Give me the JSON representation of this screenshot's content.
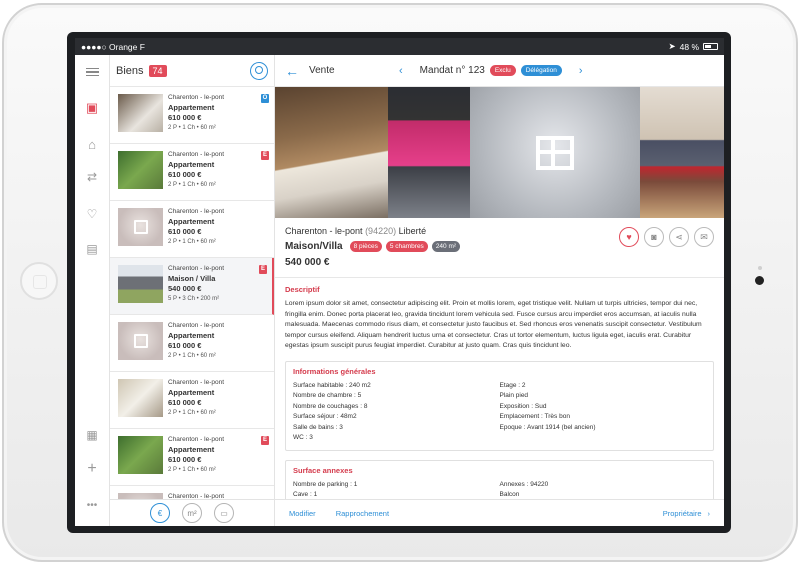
{
  "statusbar": {
    "carrier": "●●●●○ Orange F",
    "time": "",
    "battery": "48 %"
  },
  "list": {
    "title": "Biens",
    "count": "74",
    "items": [
      {
        "location": "Charenton - le-pont",
        "type": "Appartement",
        "price": "610 000 €",
        "details": "2 P • 1 Ch • 60 m²",
        "tag": "O"
      },
      {
        "location": "Charenton - le-pont",
        "type": "Appartement",
        "price": "610 000 €",
        "details": "2 P • 1 Ch • 60 m²",
        "tag": "E"
      },
      {
        "location": "Charenton - le-pont",
        "type": "Appartement",
        "price": "610 000 €",
        "details": "2 P • 1 Ch • 60 m²",
        "tag": ""
      },
      {
        "location": "Charenton - le-pont",
        "type": "Maison / Villa",
        "price": "540 000 €",
        "details": "5 P • 3 Ch • 200 m²",
        "tag": "E"
      },
      {
        "location": "Charenton - le-pont",
        "type": "Appartement",
        "price": "610 000 €",
        "details": "2 P • 1 Ch • 60 m²",
        "tag": ""
      },
      {
        "location": "Charenton - le-pont",
        "type": "Appartement",
        "price": "610 000 €",
        "details": "2 P • 1 Ch • 60 m²",
        "tag": ""
      },
      {
        "location": "Charenton - le-pont",
        "type": "Appartement",
        "price": "610 000 €",
        "details": "2 P • 1 Ch • 60 m²",
        "tag": "E"
      },
      {
        "location": "Charenton - le-pont",
        "type": "",
        "price": "",
        "details": "",
        "tag": ""
      }
    ],
    "footer": [
      "€",
      "m²",
      "▭"
    ]
  },
  "detail": {
    "back_label": "Vente",
    "mandat": "Mandat n° 123",
    "badge_exclu": "Exclu",
    "badge_delegation": "Délégation",
    "location_city": "Charenton - le-pont",
    "location_zip": "(94220)",
    "location_street": "Liberté",
    "type": "Maison/Villa",
    "pill_rooms": "8 pièces",
    "pill_bedrooms": "5 chambres",
    "pill_area": "240 m²",
    "price": "540 000 €",
    "desc_title": "Descriptif",
    "description": "Lorem ipsum dolor sit amet, consectetur adipiscing elit. Proin et mollis lorem, eget tristique velit. Nullam ut turpis ultricies, tempor dui nec, fringilla enim. Donec porta placerat leo, gravida tincidunt lorem vehicula sed. Fusce cursus arcu imperdiet eros accumsan, at iaculis nulla malesuada. Maecenas commodo risus diam, et consectetur justo faucibus et. Sed rhoncus eros venenatis suscipit consectetur. Vestibulum tempor cursus eleifend. Aliquam hendrerit luctus urna et consectetur. Cras ut tortor elementum, luctus ligula eget, iaculis erat. Curabitur egestas ipsum suscipit purus feugiat imperdiet. Curabitur at justo quam. Cras quis tincidunt leo.",
    "info_title": "Informations générales",
    "info_left": [
      "Surface habitable : 240 m2",
      "Nombre de chambre : 5",
      "Nombre de couchages : 8",
      "Surface séjour : 48m2",
      "Salle de bains : 3",
      "WC : 3"
    ],
    "info_right": [
      "Etage : 2",
      "Plain pied",
      "Exposition : Sud",
      "Emplacement : Très bon",
      "Epoque : Avant 1914 (bel ancien)"
    ],
    "annex_title": "Surface annexes",
    "annex_left": [
      "Nombre de parking : 1",
      "Cave : 1"
    ],
    "annex_right": [
      "Annexes : 94220",
      "Balcon"
    ],
    "footer_modifier": "Modifier",
    "footer_rapprochement": "Rapprochement",
    "footer_proprietaire": "Propriétaire"
  },
  "colors": {
    "accent": "#2e8fd6",
    "brand_red": "#e14b5a"
  }
}
